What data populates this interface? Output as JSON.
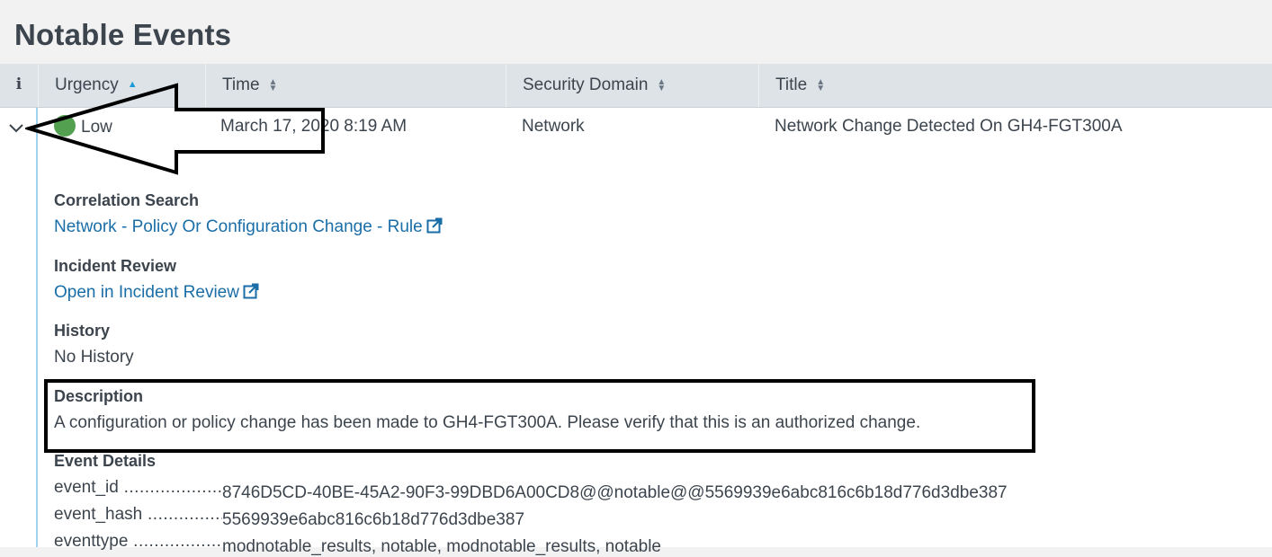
{
  "page": {
    "title": "Notable Events"
  },
  "table": {
    "headers": {
      "info": "i",
      "urgency": "Urgency",
      "time": "Time",
      "security_domain": "Security Domain",
      "title": "Title"
    },
    "sort_column": "Urgency",
    "row": {
      "urgency": "Low",
      "urgency_color": "#53a051",
      "time": "March 17, 2020 8:19 AM",
      "security_domain": "Network",
      "title": "Network Change Detected On GH4-FGT300A"
    }
  },
  "details": {
    "correlation_search": {
      "label": "Correlation Search",
      "link": "Network - Policy Or Configuration Change - Rule"
    },
    "incident_review": {
      "label": "Incident Review",
      "link": "Open in Incident Review"
    },
    "history": {
      "label": "History",
      "value": "No History"
    },
    "description": {
      "label": "Description",
      "value": "A configuration or policy change has been made to GH4-FGT300A. Please verify that this is an authorized change."
    },
    "event_details": {
      "label": "Event Details",
      "fields": [
        {
          "key": "event_id",
          "value": "8746D5CD-40BE-45A2-90F3-99DBD6A00CD8@@notable@@5569939e6abc816c6b18d776d3dbe387"
        },
        {
          "key": "event_hash",
          "value": "5569939e6abc816c6b18d776d3dbe387"
        },
        {
          "key": "eventtype",
          "value": "modnotable_results, notable, modnotable_results, notable"
        }
      ]
    }
  },
  "icons": {
    "expand": "chevron-down-icon",
    "external_link": "external-link-icon",
    "sort_asc": "sort-ascending-icon",
    "sort": "sort-icon"
  },
  "colors": {
    "accent": "#1a9bd7",
    "link": "#1a6ea8",
    "annotation": "#000000"
  }
}
